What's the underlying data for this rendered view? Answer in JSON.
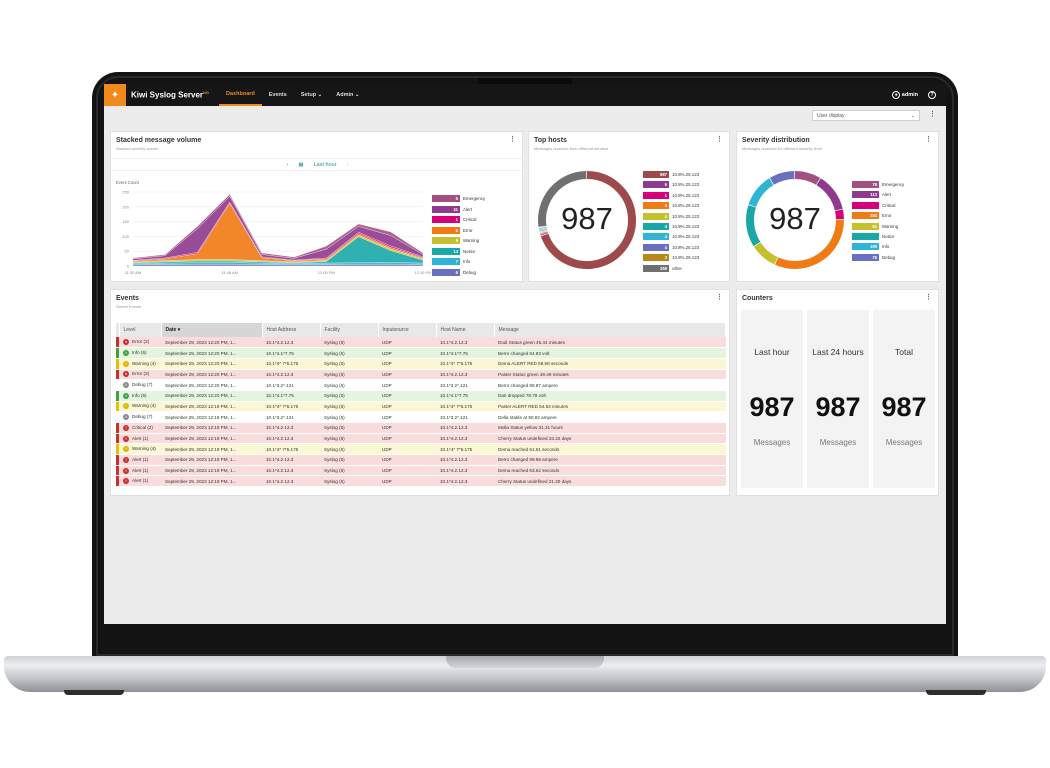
{
  "app": {
    "logo_glyph": "✦",
    "name": "Kiwi Syslog Server",
    "edition": "NG",
    "nav": [
      "Dashboard",
      "Events",
      "Setup",
      "Admin"
    ],
    "user": "admin",
    "help_glyph": "?",
    "user_display": "User display"
  },
  "volume": {
    "title": "Stacked message volume",
    "subtitle": "Stacked severity events",
    "range_label": "Last hour",
    "ylabel": "Event Count",
    "legend": [
      {
        "value": "5",
        "label": "Emergency",
        "color": "#a2507f"
      },
      {
        "value": "41",
        "label": "Alert",
        "color": "#8e3a8e"
      },
      {
        "value": "1",
        "label": "Critical",
        "color": "#d5007a"
      },
      {
        "value": "6",
        "label": "Error",
        "color": "#f07a13"
      },
      {
        "value": "9",
        "label": "Warning",
        "color": "#c5c030"
      },
      {
        "value": "14",
        "label": "Notice",
        "color": "#19a7a8"
      },
      {
        "value": "7",
        "label": "Info",
        "color": "#2fb4d4"
      },
      {
        "value": "6",
        "label": "Debug",
        "color": "#6b6fbf"
      }
    ]
  },
  "chart_data": {
    "type": "area",
    "title": "Stacked message volume",
    "ylabel": "Event Count",
    "ylim": [
      0,
      250
    ],
    "yticks": [
      "250",
      "200",
      "150",
      "100",
      "50",
      "0"
    ],
    "xticks": [
      "11:30 AM",
      "11:45 AM",
      "12:00 PM",
      "12:15 PM"
    ],
    "x": [
      "11:30 AM",
      "11:35 AM",
      "11:40 AM",
      "11:45 AM",
      "11:50 AM",
      "11:55 AM",
      "12:00 PM",
      "12:05 PM",
      "12:10 PM",
      "12:15 PM"
    ],
    "series": [
      {
        "name": "Debug",
        "color": "#6b6fbf",
        "values": [
          4,
          5,
          6,
          6,
          5,
          4,
          5,
          6,
          6,
          5
        ]
      },
      {
        "name": "Info",
        "color": "#2fb4d4",
        "values": [
          4,
          5,
          5,
          6,
          5,
          4,
          5,
          5,
          6,
          5
        ]
      },
      {
        "name": "Notice",
        "color": "#19a7a8",
        "values": [
          3,
          4,
          6,
          5,
          4,
          3,
          5,
          88,
          40,
          10
        ]
      },
      {
        "name": "Warning",
        "color": "#c5c030",
        "values": [
          3,
          4,
          5,
          5,
          4,
          3,
          4,
          5,
          6,
          4
        ]
      },
      {
        "name": "Error",
        "color": "#f07a13",
        "values": [
          3,
          6,
          20,
          190,
          10,
          4,
          5,
          6,
          5,
          4
        ]
      },
      {
        "name": "Critical",
        "color": "#d5007a",
        "values": [
          2,
          3,
          4,
          4,
          3,
          2,
          3,
          4,
          5,
          3
        ]
      },
      {
        "name": "Alert",
        "color": "#8e3a8e",
        "values": [
          5,
          8,
          80,
          20,
          8,
          6,
          30,
          20,
          35,
          8
        ]
      },
      {
        "name": "Emergency",
        "color": "#a2507f",
        "values": [
          3,
          4,
          8,
          6,
          5,
          4,
          10,
          8,
          12,
          5
        ]
      }
    ]
  },
  "top_hosts": {
    "title": "Top hosts",
    "subtitle": "Messages received from different senders",
    "total": "987",
    "legend": [
      {
        "value": "687",
        "label": "10.8%.25.123",
        "color": "#9e4a4a"
      },
      {
        "value": "5",
        "label": "10.8%.25.123",
        "color": "#8e3a8e"
      },
      {
        "value": "1",
        "label": "10.8%.25.123",
        "color": "#d5007a"
      },
      {
        "value": "4",
        "label": "10.8%.25.123",
        "color": "#f07a13"
      },
      {
        "value": "4",
        "label": "10.8%.25.123",
        "color": "#c5c030"
      },
      {
        "value": "4",
        "label": "10.8%.25.123",
        "color": "#19a7a8"
      },
      {
        "value": "4",
        "label": "10.8%.25.123",
        "color": "#2fb4d4"
      },
      {
        "value": "4",
        "label": "10.8%.25.123",
        "color": "#6b6fbf"
      },
      {
        "value": "3",
        "label": "10.8%.25.123",
        "color": "#b8861b"
      },
      {
        "value": "268",
        "label": "other",
        "color": "#707070"
      }
    ],
    "donut": [
      687,
      5,
      1,
      4,
      4,
      4,
      4,
      4,
      3,
      268
    ]
  },
  "severity": {
    "title": "Severity distribution",
    "subtitle": "Messages received for different severity level",
    "total": "987",
    "legend": [
      {
        "value": "78",
        "label": "Emergency",
        "color": "#a2507f"
      },
      {
        "value": "113",
        "label": "Alert",
        "color": "#8e3a8e"
      },
      {
        "value": "",
        "label": "Critical",
        "color": "#d5007a"
      },
      {
        "value": "284",
        "label": "Error",
        "color": "#f07a13"
      },
      {
        "value": "81",
        "label": "Warning",
        "color": "#c5c030"
      },
      {
        "value": "",
        "label": "Notice",
        "color": "#19a7a8"
      },
      {
        "value": "100",
        "label": "Info",
        "color": "#2fb4d4"
      },
      {
        "value": "76",
        "label": "Debug",
        "color": "#6b6fbf"
      }
    ],
    "donut": [
      78,
      113,
      30,
      284,
      81,
      125,
      100,
      76
    ]
  },
  "events": {
    "title": "Events",
    "subtitle": "Stored Events",
    "columns": [
      "Level",
      "Date",
      "Host Address",
      "Facility",
      "Inputsource",
      "Host Name",
      "Message"
    ],
    "rows": [
      {
        "kind": "error",
        "level": "Error (3)",
        "date": "September 29, 2023 12:20 PM, 1...",
        "host": "10.1*4.2.12.3",
        "facility": "Syslog (5)",
        "input": "UDP",
        "hostname": "10.1*4.2.12.3",
        "message": "Dodi Status green 45.44 minutes"
      },
      {
        "kind": "info",
        "level": "Info (6)",
        "date": "September 29, 2023 12:20 PM, 1...",
        "host": "10.1*4.1*7.75",
        "facility": "Syslog (5)",
        "input": "UDP",
        "hostname": "10.1*4.1*7.75",
        "message": "Berro changed 84.83 volt"
      },
      {
        "kind": "warning",
        "level": "Warning (4)",
        "date": "September 29, 2023 12:20 PM, 1...",
        "host": "10.1*4* 7*5.175",
        "facility": "Syslog (5)",
        "input": "UDP",
        "hostname": "10.1*4* 7*5.175",
        "message": "Dema ALERT RED 58.58 seconds"
      },
      {
        "kind": "error",
        "level": "Error (3)",
        "date": "September 29, 2023 12:20 PM, 1...",
        "host": "10.1*4.2.12.3",
        "facility": "Syslog (5)",
        "input": "UDP",
        "hostname": "10.1*4.2.12.3",
        "message": "Paster Status green 49.49 minutes"
      },
      {
        "kind": "debug",
        "level": "Debug (7)",
        "date": "September 29, 2023 12:20 PM, 1...",
        "host": "10.1*3.2*.121",
        "facility": "Syslog (5)",
        "input": "UDP",
        "hostname": "10.1*3.2*.121",
        "message": "Berro changed 88.87 ampere"
      },
      {
        "kind": "info",
        "level": "Info (6)",
        "date": "September 29, 2023 12:20 PM, 1...",
        "host": "10.1*4.1*7.75",
        "facility": "Syslog (5)",
        "input": "UDP",
        "hostname": "10.1*4.1*7.75",
        "message": "Dari dropped 78.78 volt"
      },
      {
        "kind": "warning",
        "level": "Warning (4)",
        "date": "September 29, 2023 12:19 PM, 1...",
        "host": "10.1*4* 7*5.175",
        "facility": "Syslog (5)",
        "input": "UDP",
        "hostname": "10.1*4* 7*5.175",
        "message": "Paster ALERT RED 54.53 minutes"
      },
      {
        "kind": "debug",
        "level": "Debug (7)",
        "date": "September 29, 2023 12:19 PM, 1...",
        "host": "10.1*3.2*.121",
        "facility": "Syslog (5)",
        "input": "UDP",
        "hostname": "10.1*3.2*.121",
        "message": "Della stable at 90.92 ampere"
      },
      {
        "kind": "critical",
        "level": "Critical (2)",
        "date": "September 29, 2023 12:19 PM, 1...",
        "host": "10.1*4.2.12.3",
        "facility": "Syslog (5)",
        "input": "UDP",
        "hostname": "10.1*4.2.12.3",
        "message": "Molla Status yellow 31.31 hours"
      },
      {
        "kind": "alert",
        "level": "Alert (1)",
        "date": "September 29, 2023 12:19 PM, 1...",
        "host": "10.1*4.2.12.3",
        "facility": "Syslog (5)",
        "input": "UDP",
        "hostname": "10.1*4.2.12.3",
        "message": "Cherry Status undefined 23.22 days"
      },
      {
        "kind": "warning",
        "level": "Warning (4)",
        "date": "September 29, 2023 12:19 PM, 1...",
        "host": "10.1*4* 7*5.175",
        "facility": "Syslog (5)",
        "input": "UDP",
        "hostname": "10.1*4* 7*5.175",
        "message": "Dema reached 61.61 seconds"
      },
      {
        "kind": "alert",
        "level": "Alert (1)",
        "date": "September 29, 2023 12:19 PM, 1...",
        "host": "10.1*4.2.12.3",
        "facility": "Syslog (5)",
        "input": "UDP",
        "hostname": "10.1*4.2.12.3",
        "message": "Berro changed 89.88 ampere"
      },
      {
        "kind": "alert",
        "level": "Alert (1)",
        "date": "September 29, 2023 12:19 PM, 1...",
        "host": "10.1*4.2.12.3",
        "facility": "Syslog (5)",
        "input": "UDP",
        "hostname": "10.1*4.2.12.3",
        "message": "Dema reached 63.62 seconds"
      },
      {
        "kind": "alert",
        "level": "Alert (1)",
        "date": "September 29, 2023 12:19 PM, 1...",
        "host": "10.1*4.2.12.3",
        "facility": "Syslog (5)",
        "input": "UDP",
        "hostname": "10.1*4.2.12.3",
        "message": "Cherry Status undefined 21.20 days"
      }
    ]
  },
  "counters": {
    "title": "Counters",
    "items": [
      {
        "label": "Last hour",
        "value": "987",
        "unit": "Messages"
      },
      {
        "label": "Last 24 hours",
        "value": "987",
        "unit": "Messages"
      },
      {
        "label": "Total",
        "value": "987",
        "unit": "Messages"
      }
    ]
  },
  "level_style": {
    "error": {
      "row": "#f9dcdc",
      "stripe": "#c9302c",
      "icon": "#c9302c",
      "glyph": "×"
    },
    "alert": {
      "row": "#f9dcdc",
      "stripe": "#c9302c",
      "icon": "#c9302c",
      "glyph": "!"
    },
    "critical": {
      "row": "#f9dcdc",
      "stripe": "#c9302c",
      "icon": "#c9302c",
      "glyph": "!"
    },
    "info": {
      "row": "#e3f4df",
      "stripe": "#3fa33f",
      "icon": "#3fa33f",
      "glyph": "i"
    },
    "warning": {
      "row": "#fbf6d3",
      "stripe": "#e2c200",
      "icon": "#e2b400",
      "glyph": "!"
    },
    "debug": {
      "row": "#ffffff",
      "stripe": "#ffffff",
      "icon": "#8a8a8a",
      "glyph": "i"
    }
  }
}
